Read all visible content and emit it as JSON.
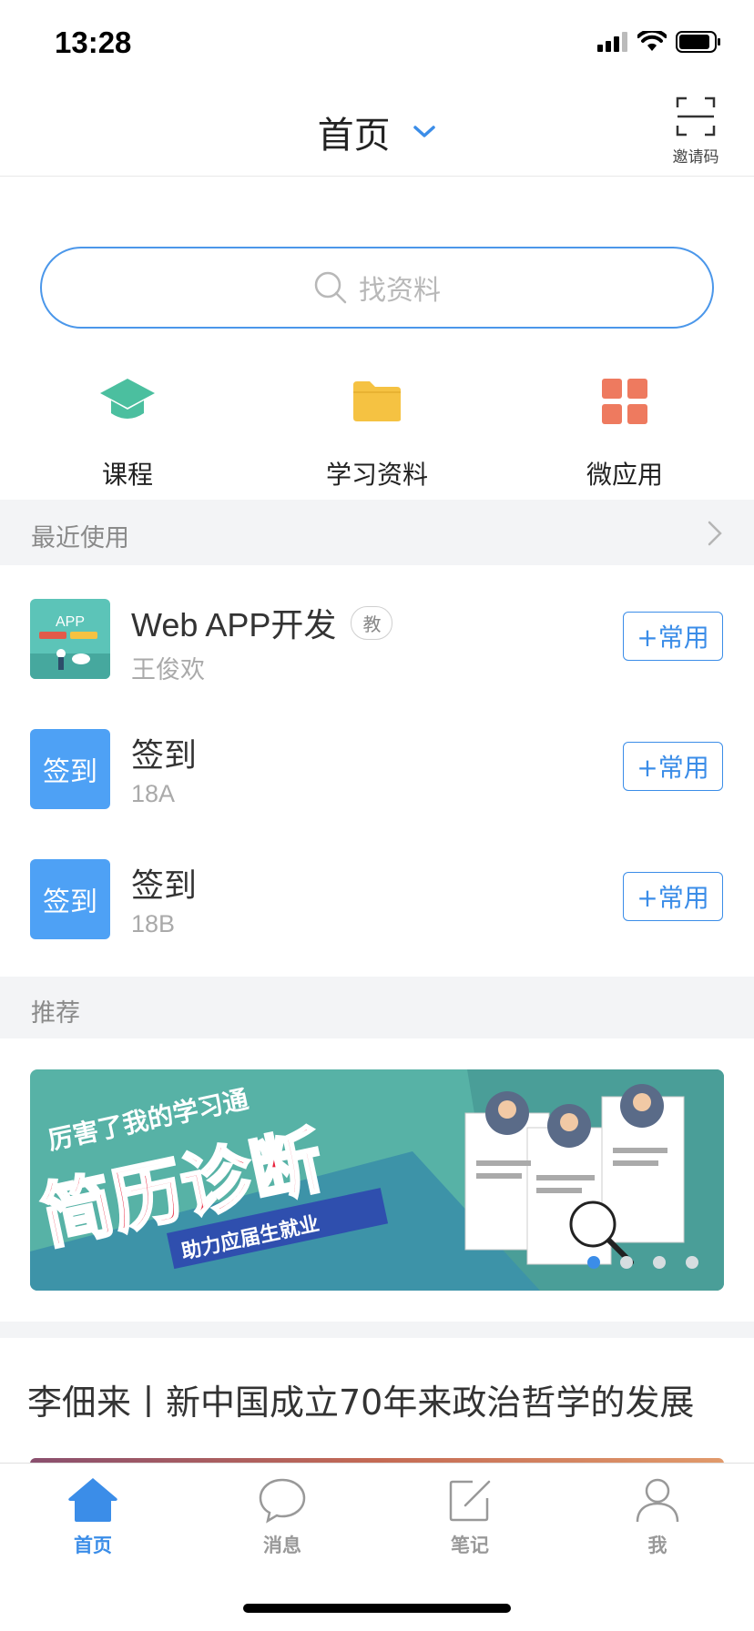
{
  "status_bar": {
    "time": "13:28"
  },
  "header": {
    "title": "首页",
    "invite_label": "邀请码"
  },
  "search": {
    "placeholder": "找资料"
  },
  "quick_entries": [
    {
      "label": "课程",
      "icon": "graduation-cap-icon",
      "color": "#4bbf9f"
    },
    {
      "label": "学习资料",
      "icon": "folder-icon",
      "color": "#f5c242"
    },
    {
      "label": "微应用",
      "icon": "grid-icon",
      "color": "#ee7a5f"
    }
  ],
  "recent": {
    "title": "最近使用",
    "items": [
      {
        "title": "Web APP开发",
        "badge": "教",
        "subtitle": "王俊欢",
        "fav_label": "+常用",
        "thumb": {
          "text": "APP"
        }
      },
      {
        "title": "签到",
        "subtitle": "18A",
        "fav_label": "+常用",
        "thumb": {
          "text": "签到"
        }
      },
      {
        "title": "签到",
        "subtitle": "18B",
        "fav_label": "+常用",
        "thumb": {
          "text": "签到"
        }
      }
    ]
  },
  "recommend": {
    "title": "推荐",
    "banner": {
      "line1": "厉害了我的学习通",
      "line2": "简历诊断",
      "line3": "助力应届生就业",
      "active_dot": 1,
      "dot_count": 4
    }
  },
  "article": {
    "title": "李佃来丨新中国成立70年来政治哲学的发展"
  },
  "tabbar": [
    {
      "label": "首页",
      "icon": "home-icon",
      "active": true
    },
    {
      "label": "消息",
      "icon": "chat-bubble-icon",
      "active": false
    },
    {
      "label": "笔记",
      "icon": "note-edit-icon",
      "active": false
    },
    {
      "label": "我",
      "icon": "user-icon",
      "active": false
    }
  ],
  "colors": {
    "accent": "#3b8de8",
    "sign_tile": "#4ea1f5",
    "section_bg": "#f3f4f6"
  }
}
